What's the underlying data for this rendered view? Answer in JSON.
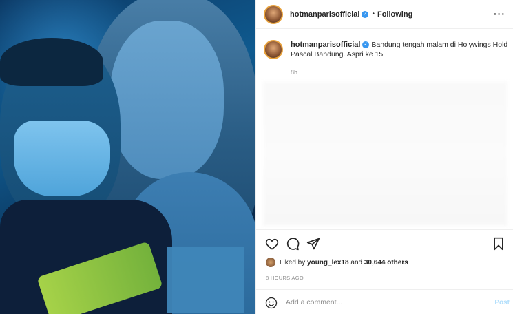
{
  "post": {
    "username": "hotmanparisofficial",
    "follow_status": "Following",
    "separator": "•",
    "more_icon": "more-horizontal-icon",
    "caption": {
      "username": "hotmanparisofficial",
      "text": "Bandung tengah malam di Holywings Hold Pascal Bandung. Aspri ke 15",
      "time": "8h"
    },
    "likes": {
      "prefix": "Liked by",
      "liker": "young_lex18",
      "and": "and",
      "count": "30,644 others"
    },
    "date": "8 HOURS AGO",
    "comment": {
      "placeholder": "Add a comment...",
      "post_label": "Post"
    },
    "colors": {
      "verified": "#3897f0",
      "post_button": "#b2dffc",
      "border": "#efefef"
    }
  }
}
